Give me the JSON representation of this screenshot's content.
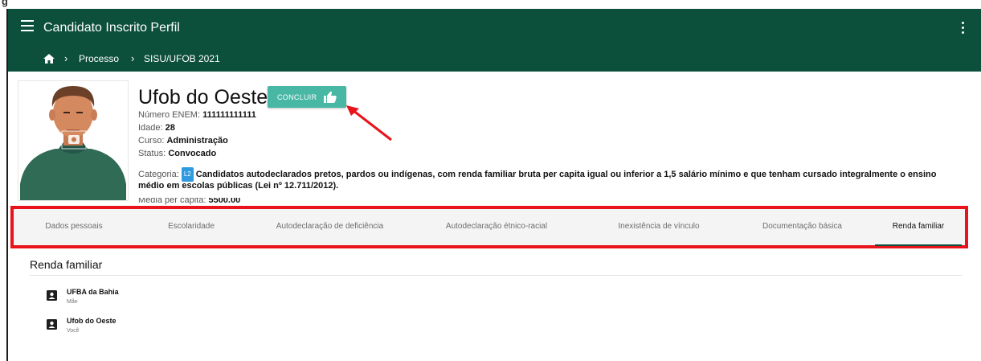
{
  "app": {
    "title": "Candidato Inscrito Perfil"
  },
  "breadcrumb": {
    "items": [
      "Processo",
      "SISU/UFOB 2021"
    ]
  },
  "top_strip_text": "g",
  "candidate": {
    "name": "Ufob do Oeste",
    "conclude_label": "CONCLUIR",
    "fields": {
      "enem_label": "Número ENEM:",
      "enem_value": "111111111111",
      "idade_label": "Idade:",
      "idade_value": "28",
      "curso_label": "Curso:",
      "curso_value": "Administração",
      "status_label": "Status:",
      "status_value": "Convocado",
      "categoria_label": "Categoria:",
      "categoria_badge": "L2",
      "categoria_value": "Candidatos autodeclarados pretos, pardos ou indígenas, com renda familiar bruta per capita igual ou inferior a 1,5 salário mínimo e que tenham cursado integralmente o ensino",
      "categoria_value_2": "médio em escolas públicas (Lei nº 12.711/2012).",
      "media_label": "Média per capita:",
      "media_value": "5500.00"
    }
  },
  "tabs": [
    "Dados pessoais",
    "Escolaridade",
    "Autodeclaração de deficiência",
    "Autodeclaração étnico-racial",
    "Inexistência de vínculo",
    "Documentação básica",
    "Renda familiar"
  ],
  "active_tab": "Renda familiar",
  "renda": {
    "title": "Renda familiar",
    "members": [
      {
        "name": "UFBA da Bahia",
        "relation": "Mãe"
      },
      {
        "name": "Ufob do Oeste",
        "relation": "Você"
      }
    ]
  },
  "colors": {
    "appbar": "#0c4f3b",
    "button": "#48b7a4",
    "highlight": "#e8131b",
    "badge": "#2f9ae0"
  }
}
